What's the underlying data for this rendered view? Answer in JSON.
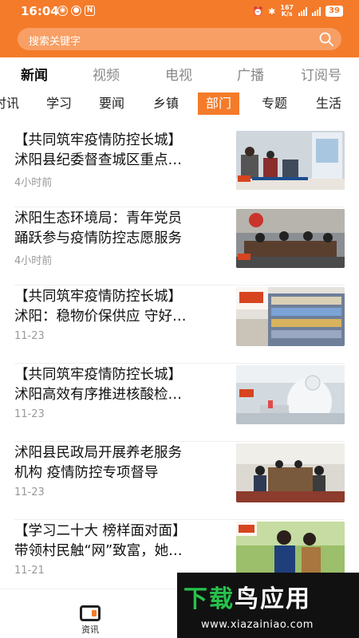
{
  "status_bar": {
    "time": "16:04",
    "speed": "167\nK/s",
    "battery": "39"
  },
  "search": {
    "placeholder": "搜索关键字"
  },
  "tabs": [
    {
      "label": "新闻",
      "active": true
    },
    {
      "label": "视频",
      "active": false
    },
    {
      "label": "电视",
      "active": false
    },
    {
      "label": "广播",
      "active": false
    },
    {
      "label": "订阅号",
      "active": false
    }
  ],
  "subtabs": [
    {
      "label": "时讯",
      "active": false
    },
    {
      "label": "学习",
      "active": false
    },
    {
      "label": "要闻",
      "active": false
    },
    {
      "label": "乡镇",
      "active": false
    },
    {
      "label": "部门",
      "active": true
    },
    {
      "label": "专题",
      "active": false
    },
    {
      "label": "生活",
      "active": false
    }
  ],
  "news": [
    {
      "line1": "【共同筑牢疫情防控长城】",
      "line2": "沭阳县纪委督查城区重点…",
      "time": "4小时前"
    },
    {
      "line1": "沭阳生态环境局：青年党员",
      "line2": "踊跃参与疫情防控志愿服务",
      "time": "4小时前"
    },
    {
      "line1": "【共同筑牢疫情防控长城】",
      "line2": "沭阳：稳物价保供应 守好…",
      "time": "11-23"
    },
    {
      "line1": "【共同筑牢疫情防控长城】",
      "line2": "沭阳高效有序推进核酸检…",
      "time": "11-23"
    },
    {
      "line1": "沭阳县民政局开展养老服务",
      "line2": "机构 疫情防控专项督导",
      "time": "11-23"
    },
    {
      "line1": "【学习二十大 榜样面对面】",
      "line2": "带领村民触“网”致富，她…",
      "time": "11-21"
    }
  ],
  "bottom_nav": {
    "label": "资讯"
  },
  "watermark": {
    "brand_a": "下载",
    "brand_b": "鸟应用",
    "url": "www.xiazainiao.com"
  },
  "colors": {
    "accent": "#f47b2a"
  }
}
